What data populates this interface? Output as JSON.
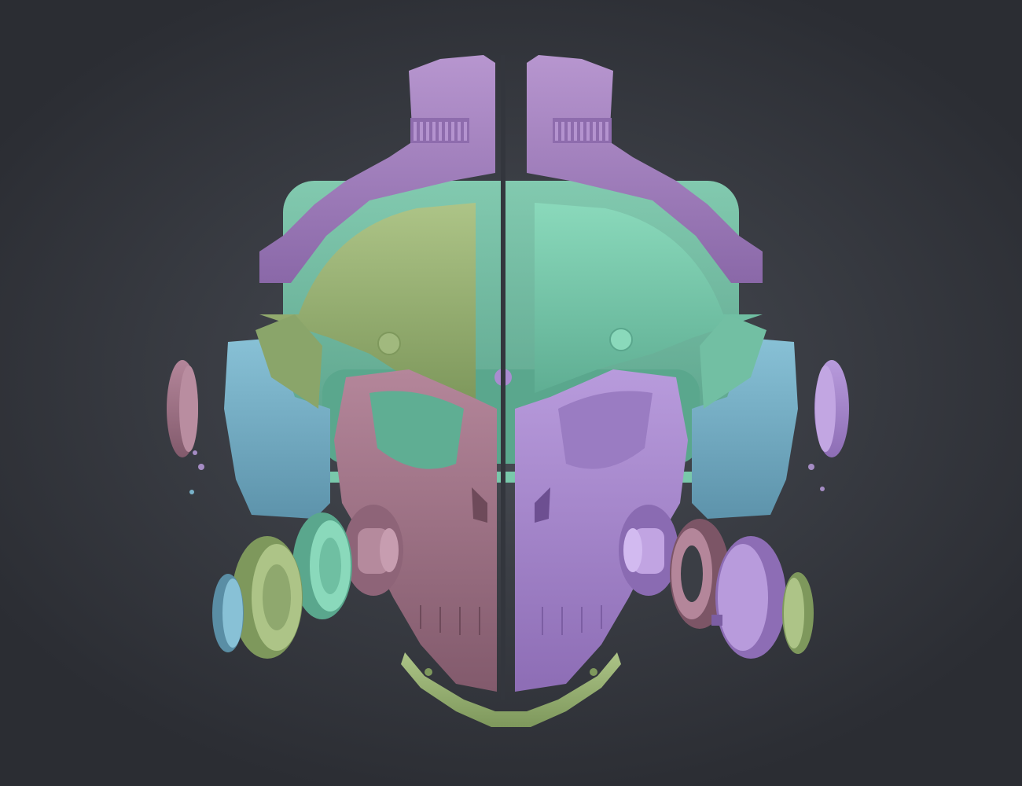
{
  "image": {
    "subject": "",
    "background_color": "#3a3d44"
  },
  "colors": {
    "purple": "#a887c2",
    "purple_dark": "#7e5f9a",
    "mint": "#7fcfb0",
    "mint_dark": "#5aa78d",
    "olive": "#9fb87a",
    "olive_dark": "#7a9259",
    "mauve": "#a4778a",
    "mauve_dark": "#7c5566",
    "blue": "#79b2c9",
    "blue_dark": "#5a8ea5",
    "lilac": "#a98cd0"
  }
}
